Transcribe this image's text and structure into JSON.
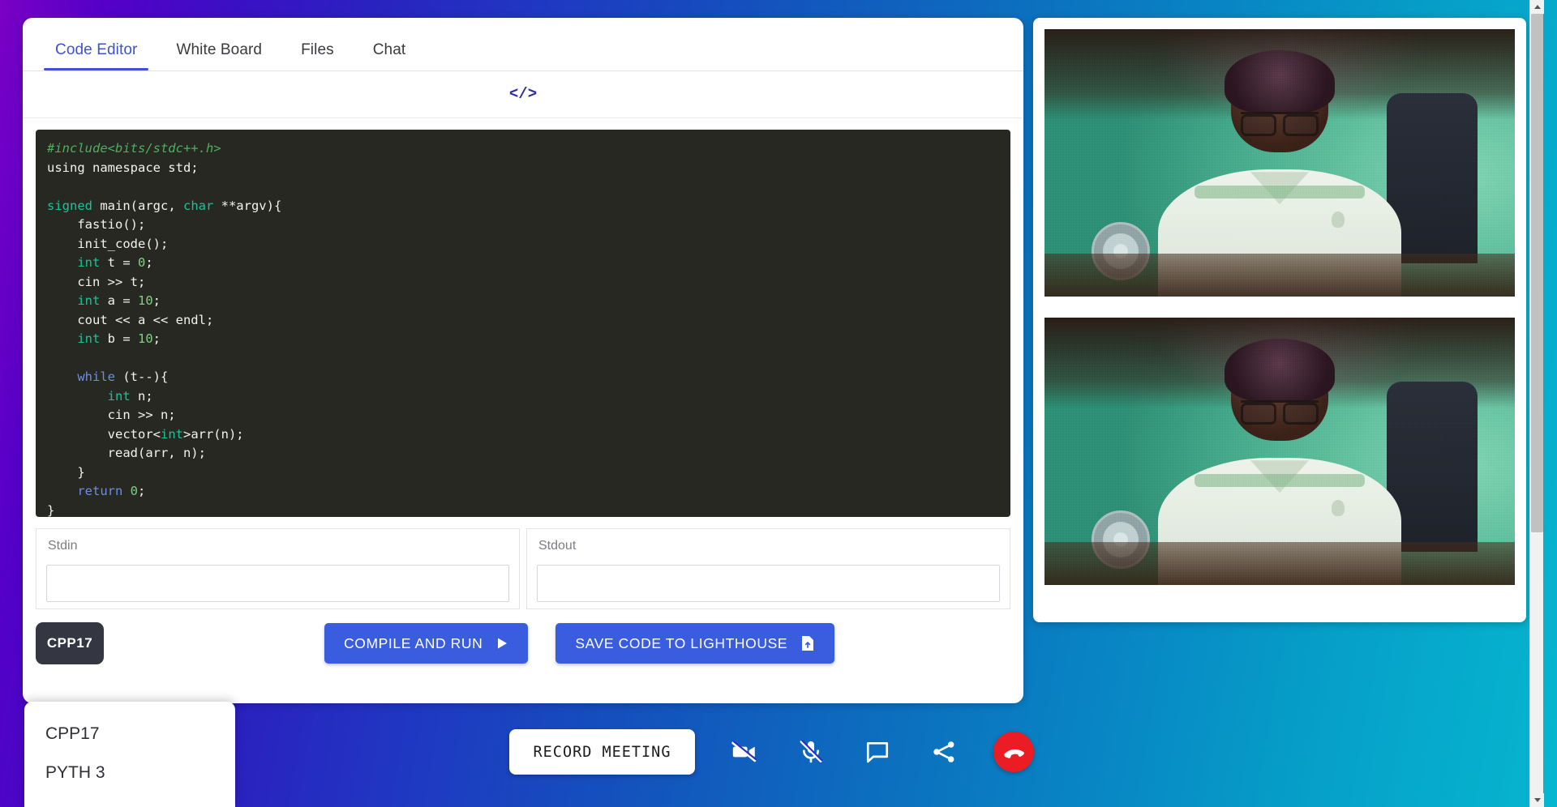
{
  "app": {
    "background_gradient_from": "#7a00c4",
    "background_gradient_to": "#06b6cf"
  },
  "editor": {
    "tabs": [
      {
        "label": "Code Editor",
        "active": true
      },
      {
        "label": "White Board",
        "active": false
      },
      {
        "label": "Files",
        "active": false
      },
      {
        "label": "Chat",
        "active": false
      }
    ],
    "toolbar": {
      "code_icon": "</>",
      "code_icon_name": "code-brackets-icon",
      "accent_color": "#2b2ba8"
    },
    "code": {
      "language_highlight": "cpp",
      "background": "#272822",
      "lines": [
        "#include<bits/stdc++.h>",
        "using namespace std;",
        "",
        "signed main(argc, char **argv){",
        "    fastio();",
        "    init_code();",
        "    int t = 0;",
        "    cin >> t;",
        "    int a = 10;",
        "    cout << a << endl;",
        "    int b = 10;",
        "",
        "    while (t--){",
        "        int n;",
        "        cin >> n;",
        "        vector<int>arr(n);",
        "        read(arr, n);",
        "    }",
        "    return 0;",
        "}"
      ]
    },
    "stdin": {
      "label": "Stdin",
      "value": "",
      "placeholder": ""
    },
    "stdout": {
      "label": "Stdout",
      "value": "",
      "placeholder": ""
    },
    "actions": {
      "language_button": "CPP17",
      "compile_and_run": "COMPILE AND RUN",
      "compile_and_run_icon": "play-icon",
      "save_code": "SAVE CODE TO LIGHTHOUSE",
      "save_code_icon": "file-upload-icon",
      "button_color": "#3a5de0"
    },
    "language_dropdown": {
      "open": true,
      "options": [
        {
          "label": "CPP17"
        },
        {
          "label": "PYTH 3"
        }
      ]
    }
  },
  "video": {
    "tiles": [
      {
        "name": "participant-video-1"
      },
      {
        "name": "participant-video-2"
      }
    ]
  },
  "meeting_bar": {
    "record_label": "RECORD MEETING",
    "controls": [
      {
        "name": "camera-off-icon",
        "state": "off"
      },
      {
        "name": "microphone-off-icon",
        "state": "off"
      },
      {
        "name": "chat-icon",
        "state": "on"
      },
      {
        "name": "share-icon",
        "state": "on"
      },
      {
        "name": "end-call-icon",
        "state": "on",
        "color": "#ec1c24"
      }
    ]
  },
  "scrollbar": {
    "visible": true
  }
}
